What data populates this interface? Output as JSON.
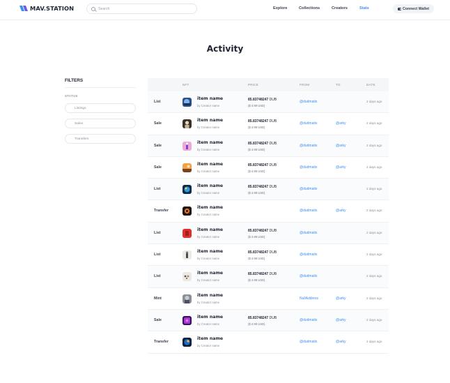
{
  "header": {
    "logo_text": "MAV.STATION",
    "search_placeholder": "Search",
    "nav": [
      "Explore",
      "Collections",
      "Creators",
      "Stats"
    ],
    "active_nav": "Stats",
    "connect_label": "Connect Wallet"
  },
  "page": {
    "title": "Activity"
  },
  "filters": {
    "heading": "FILTERS",
    "status_label": "STATUS",
    "options": [
      "Listings",
      "Sales",
      "Transfers"
    ]
  },
  "table": {
    "columns": [
      "NFT",
      "PRICE",
      "FROM",
      "TO",
      "DATE"
    ],
    "rows": [
      {
        "event": "List",
        "name": "item name",
        "creator": "by Creator name",
        "price_value": "85.83748247",
        "currency": "DUB",
        "usd": "($ 4.99 USD)",
        "from": "@dudmatix",
        "to": "",
        "date": "2 days ago",
        "thumb": "blue-shape"
      },
      {
        "event": "Sale",
        "name": "item name",
        "creator": "by Creator name",
        "price_value": "85.83748247",
        "currency": "DUB",
        "usd": "($ 4.99 USD)",
        "from": "@dudmatix",
        "to": "@arky",
        "date": "2 days ago",
        "thumb": "portrait"
      },
      {
        "event": "Sale",
        "name": "item name",
        "creator": "by Creator name",
        "price_value": "85.83748247",
        "currency": "DUB",
        "usd": "($ 4.99 USD)",
        "from": "@dudmatix",
        "to": "@arky",
        "date": "2 days ago",
        "thumb": "pink-figure"
      },
      {
        "event": "Sale",
        "name": "item name",
        "creator": "by Creator name",
        "price_value": "85.83748247",
        "currency": "DUB",
        "usd": "($ 4.99 USD)",
        "from": "@dudmatix",
        "to": "@arky",
        "date": "2 days ago",
        "thumb": "desert"
      },
      {
        "event": "List",
        "name": "item name",
        "creator": "by Creator name",
        "price_value": "85.83748247",
        "currency": "DUB",
        "usd": "($ 4.99 USD)",
        "from": "@dudmatix",
        "to": "",
        "date": "2 days ago",
        "thumb": "planet"
      },
      {
        "event": "Transfer",
        "name": "item name",
        "creator": "by Creator name",
        "price_value": "",
        "currency": "",
        "usd": "",
        "from": "@dudmatix",
        "to": "@arky",
        "date": "2 days ago",
        "thumb": "orange-dark"
      },
      {
        "event": "List",
        "name": "item name",
        "creator": "by Creator name",
        "price_value": "85.83748247",
        "currency": "DUB",
        "usd": "($ 4.99 USD)",
        "from": "@dudmatix",
        "to": "",
        "date": "2 days ago",
        "thumb": "red"
      },
      {
        "event": "List",
        "name": "item name",
        "creator": "by Creator name",
        "price_value": "85.83748247",
        "currency": "DUB",
        "usd": "($ 4.99 USD)",
        "from": "@dudmatix",
        "to": "",
        "date": "2 days ago",
        "thumb": "sketch"
      },
      {
        "event": "List",
        "name": "item name",
        "creator": "by Creator name",
        "price_value": "85.83748247",
        "currency": "DUB",
        "usd": "($ 4.99 USD)",
        "from": "@dudmatix",
        "to": "",
        "date": "2 days ago",
        "thumb": "dots"
      },
      {
        "event": "Mint",
        "name": "item name",
        "creator": "by Creator name",
        "price_value": "",
        "currency": "",
        "usd": "",
        "from": "NullAddress",
        "to": "@arky",
        "date": "2 days ago",
        "thumb": "grey-figure"
      },
      {
        "event": "Sale",
        "name": "item name",
        "creator": "by Creator name",
        "price_value": "85.83748247",
        "currency": "DUB",
        "usd": "($ 4.99 USD)",
        "from": "@dudmatix",
        "to": "@arky",
        "date": "2 days ago",
        "thumb": "purple"
      },
      {
        "event": "Transfer",
        "name": "item name",
        "creator": "by Creator name",
        "price_value": "",
        "currency": "",
        "usd": "",
        "from": "@dudmatix",
        "to": "@arky",
        "date": "2 days ago",
        "thumb": "planet-blue"
      }
    ]
  },
  "colors": {
    "accent": "#3d8ef3",
    "text": "#1f2430",
    "muted": "#8a8f99"
  }
}
